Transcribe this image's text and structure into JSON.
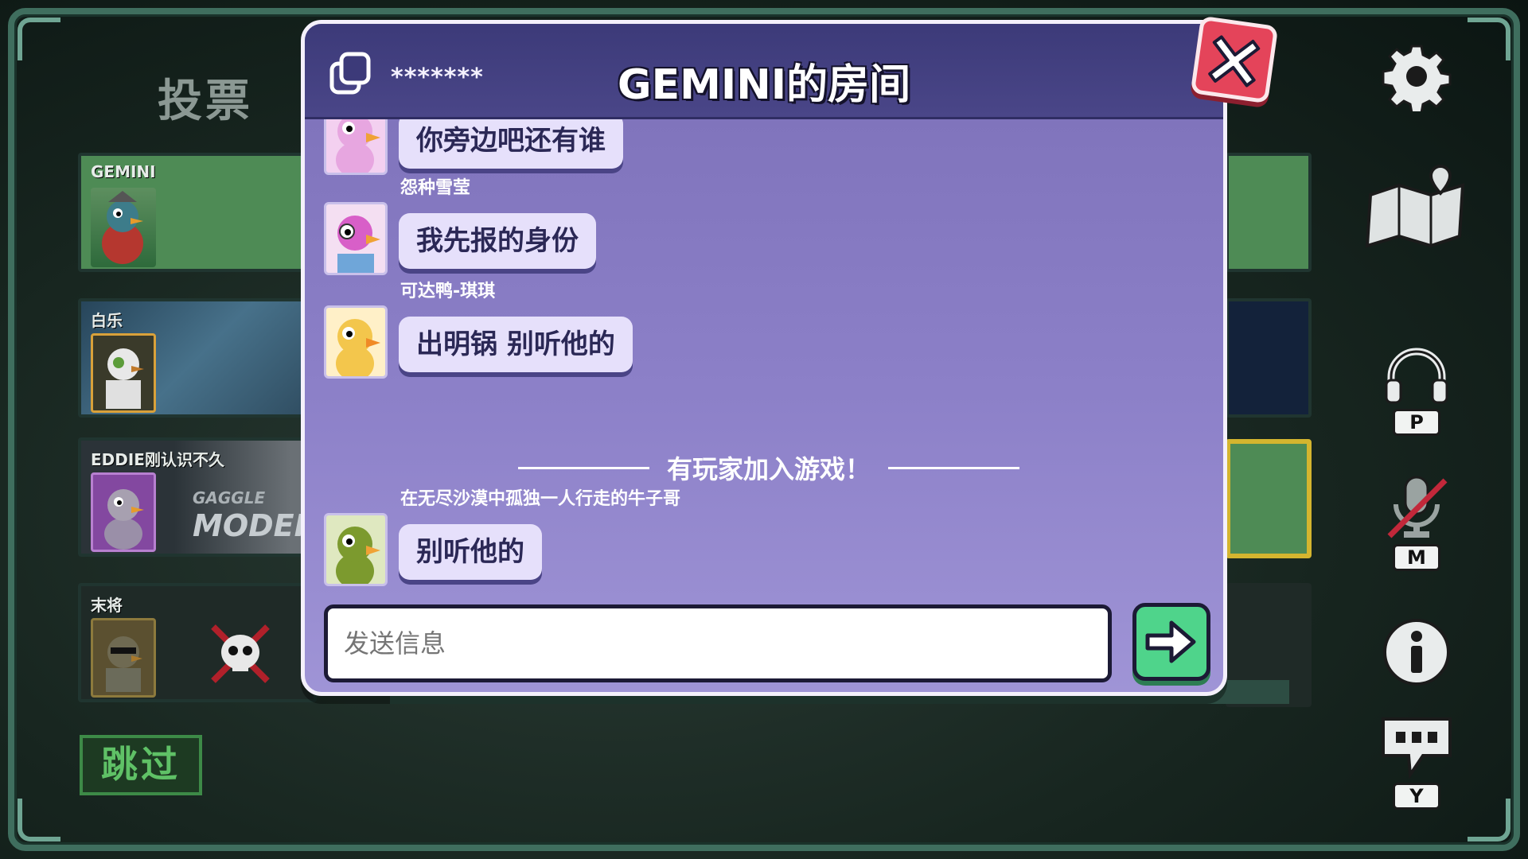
{
  "left_panel": {
    "title": "投票",
    "skip_label": "跳过",
    "players": [
      {
        "name": "GEMINI"
      },
      {
        "name": "白乐"
      },
      {
        "name": "EDDIE刚认识不久",
        "brand_top": "GAGGLE",
        "brand_bottom": "MODERA"
      },
      {
        "name": "末将"
      }
    ]
  },
  "chat": {
    "room_code": "*******",
    "title": "GEMINI的房间",
    "messages": [
      {
        "sender": "",
        "text": "你旁边吧还有谁",
        "avatar_color": "#e7a6e0"
      },
      {
        "sender": "怨种雪莹",
        "text": "我先报的身份",
        "avatar_color": "#d85fc8"
      },
      {
        "sender": "可达鸭-琪琪",
        "text": "出明锅 别听他的",
        "avatar_color": "#f3c64c"
      },
      {
        "sender": "在无尽沙漠中孤独一人行走的牛子哥",
        "text": "别听他的",
        "avatar_color": "#7c9a2e"
      }
    ],
    "system_message": "有玩家加入游戏！",
    "input_placeholder": "发送信息"
  },
  "right_controls": {
    "push_to_talk_key": "P",
    "mute_key": "M",
    "chat_key": "Y"
  },
  "colors": {
    "modal_bg": "#8c80c8",
    "header_bg": "#3c3a79",
    "bubble_bg": "#e6e0fb",
    "send_green": "#4fd48b",
    "close_red": "#e4445a",
    "vote_green": "#4e8b55",
    "skip_green": "#5fc166"
  }
}
